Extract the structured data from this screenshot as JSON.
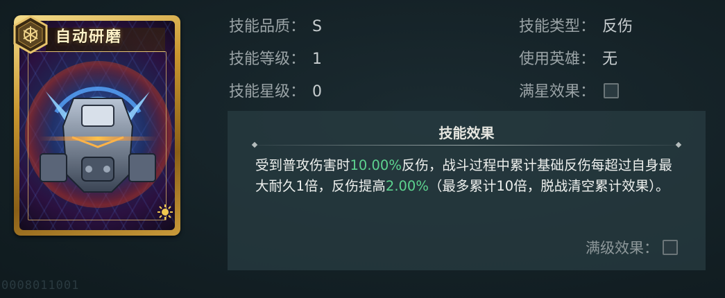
{
  "card": {
    "title": "自动研磨",
    "icons": [
      "hex-emblem-icon",
      "sun-gear-icon"
    ]
  },
  "info": {
    "quality_label": "技能品质：",
    "quality_value": "S",
    "level_label": "技能等级：",
    "level_value": "1",
    "star_label": "技能星级：",
    "star_value": "0",
    "type_label": "技能类型：",
    "type_value": "反伤",
    "hero_label": "使用英雄：",
    "hero_value": "无",
    "full_star_label": "满星效果："
  },
  "effect": {
    "title": "技能效果",
    "desc_1": "受到普攻伤害时",
    "desc_hl_1": "10.00%",
    "desc_2": "反伤，战斗过程中累计基础反伤每超过自身最大耐久1倍，反伤提高",
    "desc_hl_2": "2.00%",
    "desc_3": "（最多累计10倍，脱战清空累计效果）。",
    "full_level_label": "满级效果："
  },
  "colors": {
    "highlight": "#5dd38f",
    "label": "#9aa3a6",
    "value": "#c8ced0"
  },
  "watermark": "0008011001"
}
